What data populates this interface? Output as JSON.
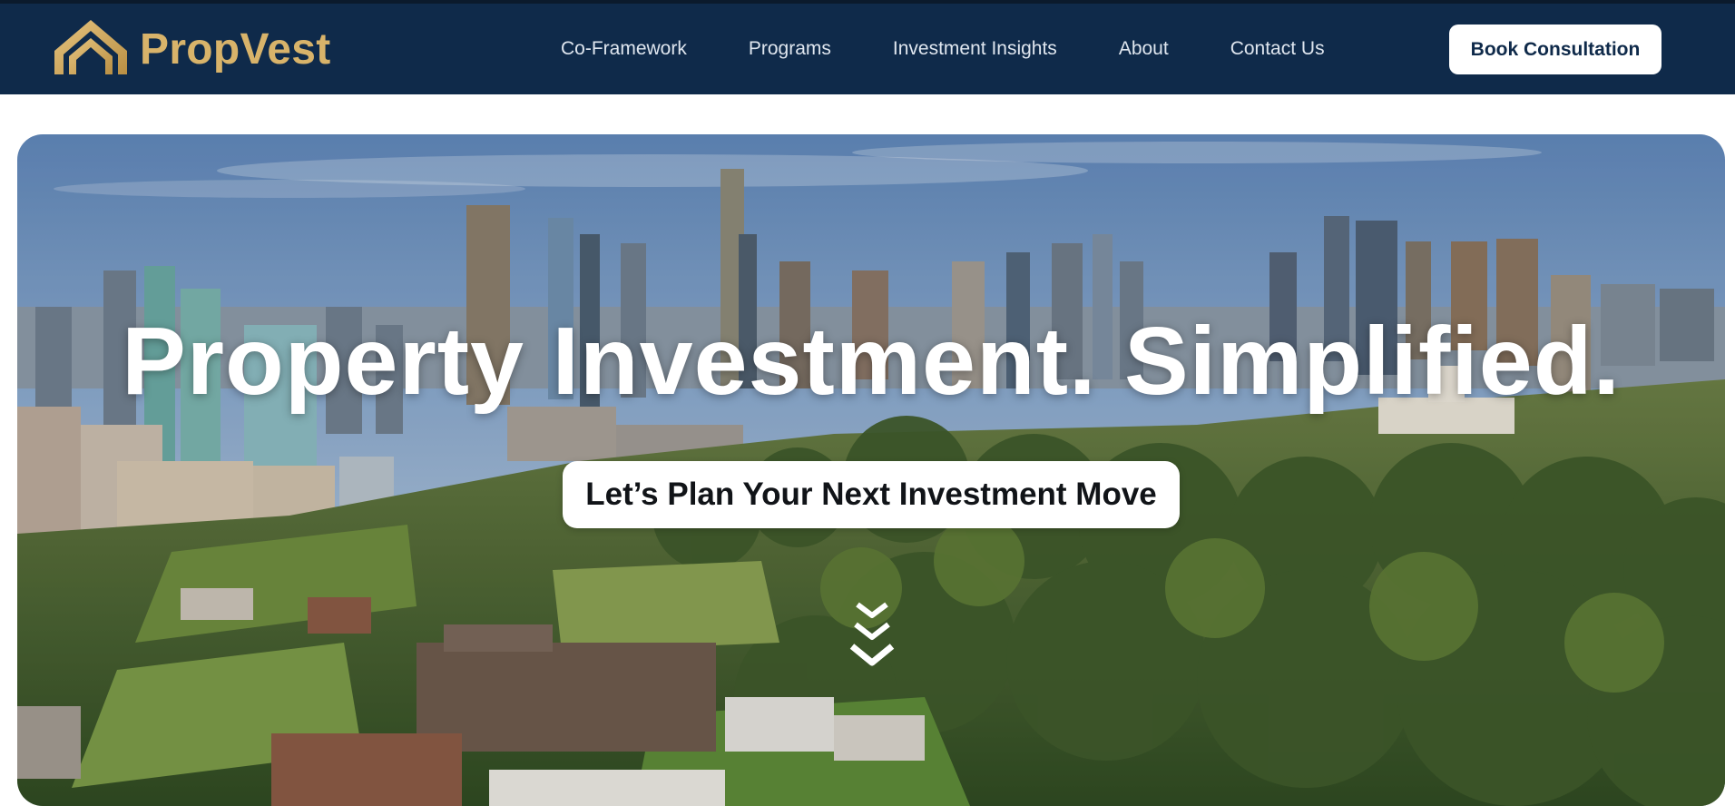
{
  "brand": {
    "name": "PropVest",
    "logo_icon": "house-roof-icon",
    "accent_color": "#d8b36a",
    "nav_bg": "#0f2a4a"
  },
  "nav": {
    "items": [
      {
        "label": "Co-Framework"
      },
      {
        "label": "Programs"
      },
      {
        "label": "Investment Insights"
      },
      {
        "label": "About"
      },
      {
        "label": "Contact Us"
      }
    ],
    "cta_label": "Book Consultation"
  },
  "hero": {
    "title": "Property Investment. Simplified.",
    "cta_label": "Let’s Plan Your Next Investment Move",
    "scroll_icon": "chevrons-down-icon"
  }
}
